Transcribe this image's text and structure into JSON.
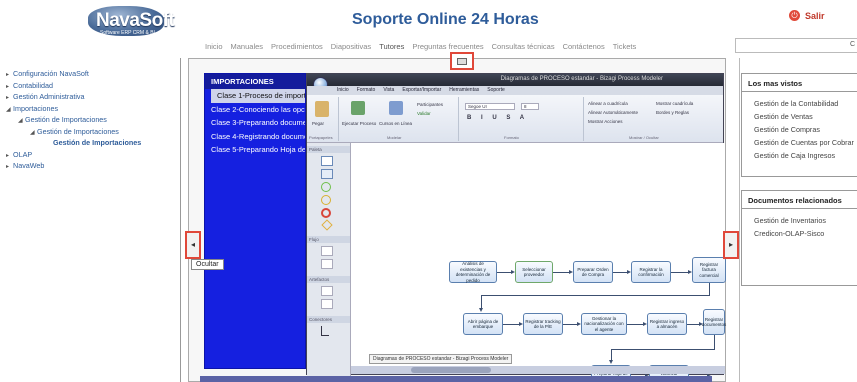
{
  "brand": {
    "name": "NavaSoft",
    "tagline": "Software ERP CRM & BI"
  },
  "header": {
    "title": "Soporte Online 24 Horas",
    "exit_label": "Salir",
    "exit_icon": "power-icon"
  },
  "nav": {
    "items": [
      "Inicio",
      "Manuales",
      "Procedimientos",
      "Diapositivas",
      "Tutores",
      "Preguntas frecuentes",
      "Consultas técnicas",
      "Contáctenos",
      "Tickets"
    ],
    "active": "Tutores"
  },
  "search": {
    "value": "C"
  },
  "tree": [
    {
      "label": "Configuración NavaSoft"
    },
    {
      "label": "Contabilidad"
    },
    {
      "label": "Gestión Administrativa"
    },
    {
      "label": "Importaciones"
    },
    {
      "label": "Gestión de Importaciones"
    },
    {
      "label": "Gestión de Importaciones"
    },
    {
      "label": "Gestión de Importaciones"
    },
    {
      "label": "OLAP"
    },
    {
      "label": "NavaWeb"
    }
  ],
  "tooltip": "Ocultar",
  "lessons": {
    "header": "IMPORTACIONES",
    "items": [
      "Clase 1-Proceso de importación",
      "Clase 2-Conociendo las opciones",
      "Clase 3-Preparando documentos",
      "Clase 4-Registrando documentos",
      "Clase 5-Preparando Hoja de costo"
    ]
  },
  "app": {
    "window_title": "Diagramas de PROCESO estandar - Bizagi Process Modeler",
    "menus": [
      "Inicio",
      "Formato",
      "Vista",
      "Exportar/Importar",
      "Herramientas",
      "Soporte"
    ],
    "ribbon": {
      "paste": "Pegar",
      "run": "Ejecutar Proceso",
      "online": "Cursos en Línea",
      "participants": "Participantes",
      "validate": "Validar",
      "font": "Segoe UI",
      "size": "8",
      "align_grid": "Alinear a cuadrícula",
      "auto_align": "Alinear Automáticamente",
      "show_actions": "Mostrar Acciones",
      "show_grid": "Mostrar cuadrícula",
      "edges_rules": "Bordes y Reglas",
      "groups": [
        "Portapapeles",
        "Modelar",
        "Formato",
        "Mostrar / Ocultar"
      ]
    },
    "palette": {
      "title": "Paleta",
      "sections": [
        "Flujo",
        "Artefactos",
        "Conectores"
      ]
    },
    "doc_tab": "Diagramas de PROCESO estandar - Bizagi Process Modeler",
    "nodes": [
      "Análisis de existencias y determinación de pedido",
      "Seleccionar proveedor",
      "Preparar Orden de Compra",
      "Registrar la confirmación",
      "Registrar factura comercial",
      "Abrir página de embarque",
      "Registrar tracking de la P/E",
      "Gestionar la nacionalización con el agente",
      "Registrar ingreso a almacén",
      "Registrar documentos",
      "Preparar hoja de costo",
      "Valorizar inventarios"
    ]
  },
  "most_viewed": {
    "title": "Los mas vistos",
    "items": [
      "Gestión de la Contabilidad",
      "Gestión de Ventas",
      "Gestión de Compras",
      "Gestión de Cuentas por Cobrar",
      "Gestión de Caja Ingresos"
    ]
  },
  "related": {
    "title": "Documentos relacionados",
    "items": [
      "Gestión de Inventarios",
      "Credicon-OLAP-Sisco"
    ]
  }
}
